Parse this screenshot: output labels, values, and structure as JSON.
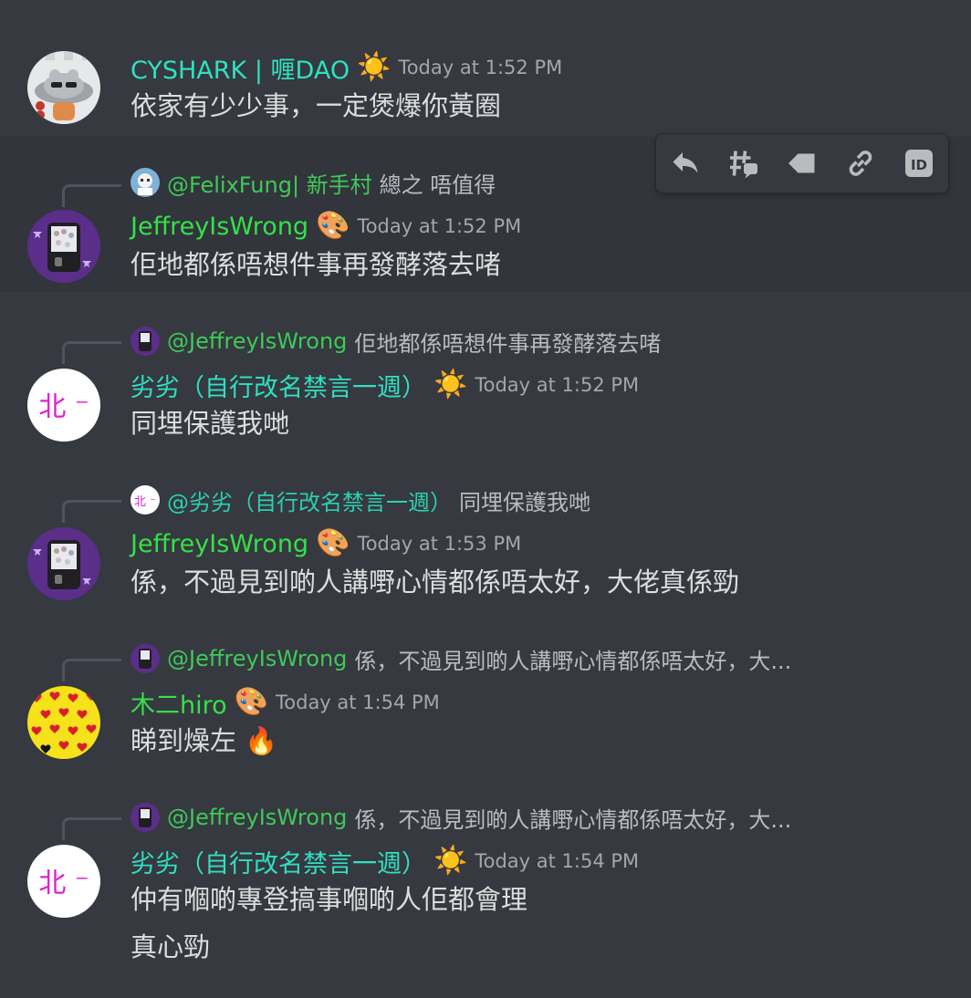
{
  "messages": [
    {
      "username": "CYSHARK | 喱DAO",
      "role_icon": "sun-icon",
      "role_glyph": "☀️",
      "timestamp": "Today at 1:52 PM",
      "lines": [
        "依家有少少事，一定煲爆你黃圈"
      ]
    },
    {
      "reply": {
        "user": "@FelixFung| 新手村",
        "text": "總之 唔值得"
      },
      "username": "JeffreyIsWrong",
      "role_icon": "palette-icon",
      "role_glyph": "🎨",
      "timestamp": "Today at 1:52 PM",
      "lines": [
        "佢地都係唔想件事再發酵落去啫"
      ]
    },
    {
      "reply": {
        "user": "@JeffreyIsWrong",
        "text": "佢地都係唔想件事再發酵落去啫"
      },
      "username": "劣劣（自行改名禁言一週）",
      "role_icon": "sun-icon",
      "role_glyph": "☀️",
      "timestamp": "Today at 1:52 PM",
      "lines": [
        "同埋保護我哋"
      ]
    },
    {
      "reply": {
        "user": "@劣劣（自行改名禁言一週）",
        "text": "同埋保護我哋"
      },
      "username": "JeffreyIsWrong",
      "role_icon": "palette-icon",
      "role_glyph": "🎨",
      "timestamp": "Today at 1:53 PM",
      "lines": [
        "係，不過見到啲人講嘢心情都係唔太好，大佬真係勁"
      ]
    },
    {
      "reply": {
        "user": "@JeffreyIsWrong",
        "text": "係，不過見到啲人講嘢心情都係唔太好，大..."
      },
      "username": "木二hiro",
      "role_icon": "palette-icon",
      "role_glyph": "🎨",
      "timestamp": "Today at 1:54 PM",
      "lines": [
        "睇到燥左 🔥"
      ]
    },
    {
      "reply": {
        "user": "@JeffreyIsWrong",
        "text": "係，不過見到啲人講嘢心情都係唔太好，大..."
      },
      "username": "劣劣（自行改名禁言一週）",
      "role_icon": "sun-icon",
      "role_glyph": "☀️",
      "timestamp": "Today at 1:54 PM",
      "lines": [
        "仲有嗰啲專登搞事嗰啲人佢都會理",
        "真心勁"
      ]
    }
  ],
  "avatar_text": {
    "lie_lie": "北 ⁻"
  },
  "toolbar": {
    "buttons": [
      "reply-icon",
      "thread-icon",
      "tag-icon",
      "link-icon",
      "copy-id-icon"
    ],
    "id_label": "ID"
  },
  "colors": {
    "background": "#36393f",
    "hover_background": "#32353b",
    "username_cyan": "#2fe0c2",
    "username_green": "#35e04a",
    "timestamp": "#a3a6aa",
    "text": "#dcddde"
  }
}
